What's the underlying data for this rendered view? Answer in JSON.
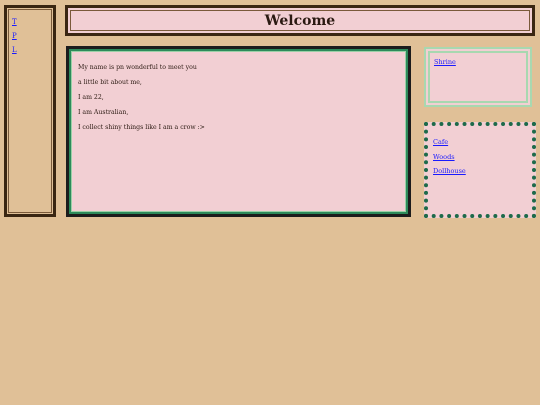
{
  "sidebar": {
    "links": [
      "T",
      "P",
      "L"
    ]
  },
  "header": {
    "title": "Welcome"
  },
  "main": {
    "lines": [
      "My name is pn wonderful to meet you",
      "a little bit about me,",
      "I am 22,",
      "I am Australian,",
      "I collect shiny things like I am a crow :>"
    ]
  },
  "shrine": {
    "link": "Shrine"
  },
  "places": {
    "links": [
      "Cafe",
      "Woods",
      "Dollhouse"
    ]
  },
  "colors": {
    "background": "#e0c097",
    "panel": "#f2cfd3",
    "border_dark": "#3a2612",
    "accent_green": "#2d8a5a",
    "mint": "#a8d8b0",
    "dot_green": "#1d6a4a",
    "link": "#1a1aff"
  }
}
